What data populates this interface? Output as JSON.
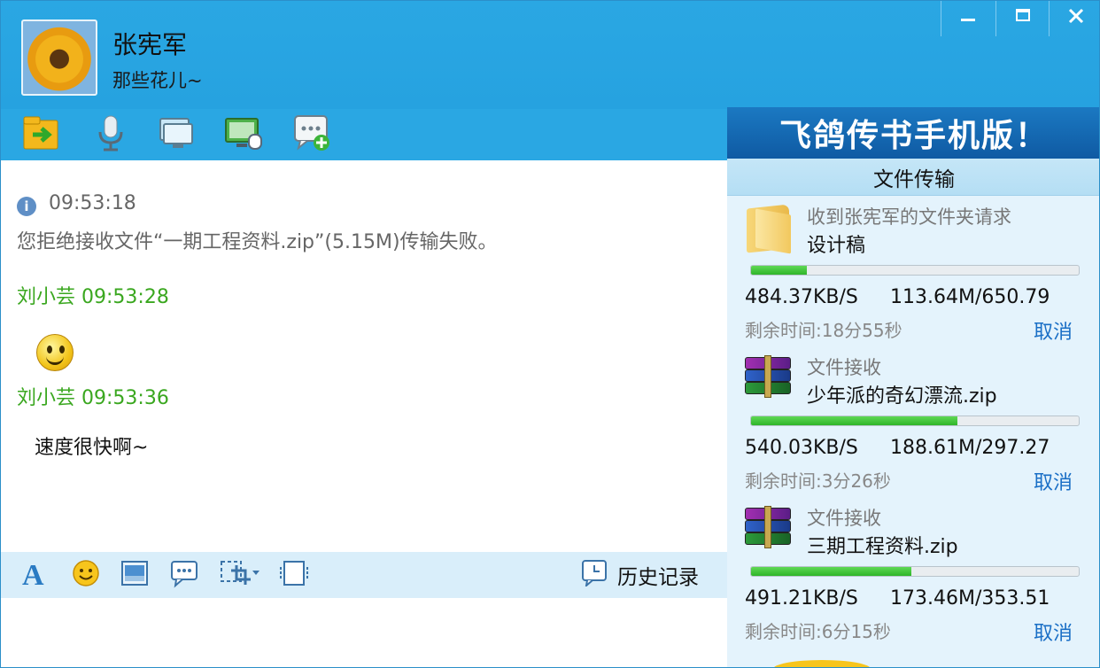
{
  "header": {
    "contact_name": "张宪军",
    "contact_signature": "那些花儿~"
  },
  "window_controls": {
    "minimize": "▁",
    "maximize": "□",
    "close": "✕"
  },
  "toolbar": {
    "icons": [
      "send-file-icon",
      "voice-icon",
      "video-icon",
      "remote-desktop-icon",
      "add-chat-icon"
    ]
  },
  "banner": {
    "text": "飞鸽传书手机版！"
  },
  "chat": {
    "messages": [
      {
        "type": "system",
        "time": "09:53:18",
        "text": "您拒绝接收文件“一期工程资料.zip”(5.15M)传输失败。"
      },
      {
        "type": "user",
        "sender": "刘小芸",
        "time": "09:53:28",
        "content": "smiley-emoticon"
      },
      {
        "type": "user",
        "sender": "刘小芸",
        "time": "09:53:36",
        "text": "速度很快啊~"
      }
    ]
  },
  "input_toolbar": {
    "icons": [
      "font-icon",
      "emoticon-icon",
      "image-icon",
      "quick-reply-icon",
      "screenshot-icon",
      "window-shake-icon"
    ],
    "history_label": "历史记录"
  },
  "file_panel": {
    "title": "文件传输",
    "items": [
      {
        "icon": "folder-icon",
        "label": "收到张宪军的文件夹请求",
        "name": "设计稿",
        "progress": 0.17,
        "speed": "484.37KB/S",
        "size": "113.64M/650.79",
        "remaining": "剩余时间:18分55秒",
        "cancel": "取消"
      },
      {
        "icon": "archive-icon",
        "label": "文件接收",
        "name": "少年派的奇幻漂流.zip",
        "progress": 0.63,
        "speed": "540.03KB/S",
        "size": "188.61M/297.27",
        "remaining": "剩余时间:3分26秒",
        "cancel": "取消"
      },
      {
        "icon": "archive-icon",
        "label": "文件接收",
        "name": "三期工程资料.zip",
        "progress": 0.49,
        "speed": "491.21KB/S",
        "size": "173.46M/353.51",
        "remaining": "剩余时间:6分15秒",
        "cancel": "取消"
      }
    ]
  },
  "colors": {
    "header_blue": "#2aa7e3",
    "sender_green": "#3aa71f",
    "link_blue": "#1a6fc6",
    "progress_green": "#2fb52a"
  }
}
